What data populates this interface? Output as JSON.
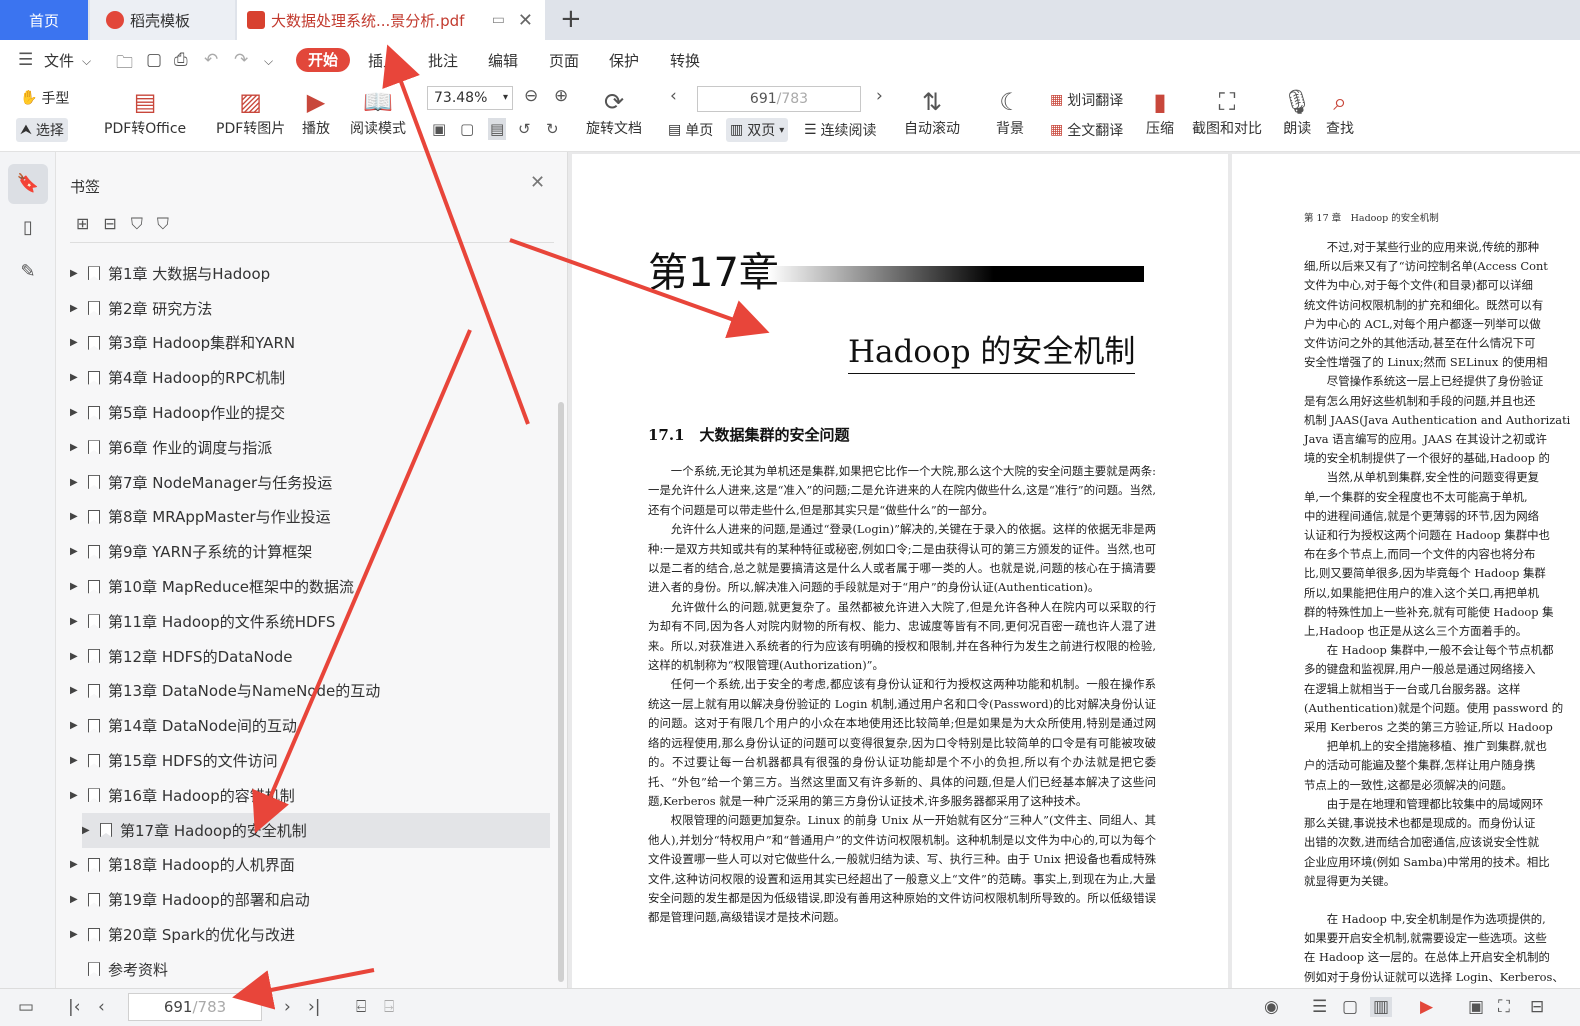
{
  "tabs": {
    "home": "首页",
    "wps": "稻壳模板",
    "doc": "大数据处理系统...景分析.pdf"
  },
  "menu": {
    "file": "文件",
    "start": "开始",
    "insert": "插入",
    "annotate": "批注",
    "edit": "编辑",
    "page": "页面",
    "protect": "保护",
    "convert": "转换"
  },
  "ribbon": {
    "hand": "手型",
    "select": "选择",
    "pdf_to_office": "PDF转Office",
    "pdf_to_image": "PDF转图片",
    "play": "播放",
    "read_mode": "阅读模式",
    "zoom": "73.48%",
    "rotate": "旋转文档",
    "page_current": "691",
    "page_total": "/783",
    "single": "单页",
    "double": "双页",
    "continuous": "连续阅读",
    "auto_scroll": "自动滚动",
    "background": "背景",
    "word_translate": "划词翻译",
    "full_translate": "全文翻译",
    "compress": "压缩",
    "screenshot_compare": "截图和对比",
    "read_aloud": "朗读",
    "find": "查找"
  },
  "panel": {
    "title": "书签",
    "bookmarks": [
      "第1章  大数据与Hadoop",
      "第2章  研究方法",
      "第3章  Hadoop集群和YARN",
      "第4章  Hadoop的RPC机制",
      "第5章  Hadoop作业的提交",
      "第6章  作业的调度与指派",
      "第7章  NodeManager与任务投运",
      "第8章  MRAppMaster与作业投运",
      "第9章  YARN子系统的计算框架",
      "第10章  MapReduce框架中的数据流",
      "第11章  Hadoop的文件系统HDFS",
      "第12章  HDFS的DataNode",
      "第13章  DataNode与NameNode的互动",
      "第14章  DataNode间的互动",
      "第15章  HDFS的文件访问",
      "第16章  Hadoop的容错机制",
      "第17章  Hadoop的安全机制",
      "第18章  Hadoop的人机界面",
      "第19章  Hadoop的部署和启动",
      "第20章  Spark的优化与改进",
      "参考资料"
    ]
  },
  "page1": {
    "chapter": "第17章",
    "title": "Hadoop 的安全机制",
    "section": "17.1　大数据集群的安全问题",
    "paragraphs": [
      "一个系统,无论其为单机还是集群,如果把它比作一个大院,那么这个大院的安全问题主要就是两条:一是允许什么人进来,这是“准入”的问题;二是允许进来的人在院内做些什么,这是“准行”的问题。当然,还有个问题是可以带走些什么,但是那其实只是“做些什么”的一部分。",
      "允许什么人进来的问题,是通过“登录(Login)”解决的,关键在于录入的依据。这样的依据无非是两种:一是双方共知或共有的某种特征或秘密,例如口令;二是由获得认可的第三方颁发的证件。当然,也可以是二者的结合,总之就是要搞清这是什么人或者属于哪一类的人。也就是说,问题的核心在于搞清要进入者的身份。所以,解决准入问题的手段就是对于“用户”的身份认证(Authentication)。",
      "允许做什么的问题,就更复杂了。虽然都被允许进入大院了,但是允许各种人在院内可以采取的行为却有不同,因为各人对院内财物的所有权、能力、忠诚度等皆有不同,更何况百密一疏也许人混了进来。所以,对获准进入系统者的行为应该有明确的授权和限制,并在各种行为发生之前进行权限的检验,这样的机制称为“权限管理(Authorization)”。",
      "任何一个系统,出于安全的考虑,都应该有身份认证和行为授权这两种功能和机制。一般在操作系统这一层上就有用以解决身份验证的 Login 机制,通过用户名和口令(Password)的比对解决身份认证的问题。这对于有限几个用户的小众在本地使用还比较简单;但是如果是为大众所使用,特别是通过网络的远程使用,那么身份认证的问题可以变得很复杂,因为口令特别是比较简单的口令是有可能被攻破的。不过要让每一台机器都具有很强的身份认证功能却是个不小的负担,所以有个办法就是把它委托、“外包”给一个第三方。当然这里面又有许多新的、具体的问题,但是人们已经基本解决了这些问题,Kerberos 就是一种广泛采用的第三方身份认证技术,许多服务器都采用了这种技术。",
      "权限管理的问题更加复杂。Linux 的前身 Unix 从一开始就有区分“三种人”(文件主、同组人、其他人),并划分“特权用户”和“普通用户”的文件访问权限机制。这种机制是以文件为中心的,可以为每个文件设置哪一些人可以对它做些什么,一般就归结为读、写、执行三种。由于 Unix 把设备也看成特殊文件,这种访问权限的设置和运用其实已经超出了一般意义上“文件”的范畴。事实上,到现在为止,大量安全问题的发生都是因为低级错误,即没有善用这种原始的文件访问权限机制所导致的。所以低级错误都是管理问题,高级错误才是技术问题。"
    ]
  },
  "page2": {
    "header": "第 17 章　Hadoop 的安全机制",
    "lines_a": [
      "不过,对于某些行业的应用来说,传统的那种",
      "细,所以后来又有了“访问控制名单(Access Cont",
      "文件为中心,对于每个文件(和目录)都可以详细",
      "统文件访问权限机制的扩充和细化。既然可以有",
      "户为中心的 ACL,对每个用户都逐一列举可以做",
      "文件访问之外的其他活动,甚至在什么情况下可",
      "安全性增强了的 Linux;然而 SELinux 的使用相",
      "尽管操作系统这一层上已经提供了身份验证",
      "是有怎么用好这些机制和手段的问题,并且也还",
      "机制 JAAS(Java Authentication and Authorizati",
      "Java 语言编写的应用。JAAS 在其设计之初或许",
      "境的安全机制提供了一个很好的基础,Hadoop 的",
      "当然,从单机到集群,安全性的问题变得更复",
      "单,一个集群的安全程度也不太可能高于单机,",
      "中的进程间通信,就是个更薄弱的环节,因为网络",
      "认证和行为授权这两个问题在 Hadoop 集群中也",
      "布在多个节点上,而同一个文件的内容也将分布",
      "比,则又要简单很多,因为毕竟每个 Hadoop 集群",
      "所以,如果能把住用户的准入这个关口,再把单机",
      "群的特殊性加上一些补充,就有可能使 Hadoop 集",
      "上,Hadoop 也正是从这么三个方面着手的。",
      "在 Hadoop 集群中,一般不会让每个节点机都",
      "多的键盘和监视屏,用户一般总是通过网络接入",
      "在逻辑上就相当于一台或几台服务器。这样",
      "(Authentication)就是个问题。使用 password 的",
      "采用 Kerberos 之类的第三方验证,所以 Hadoop",
      "把单机上的安全措施移植、推广到集群,就也",
      "户的活动可能遍及整个集群,怎样让用户随身携",
      "节点上的一致性,这都是必须解决的问题。",
      "由于是在地理和管理都比较集中的局域网环",
      "那么关键,事说技术也都是现成的。而身份认证",
      "出错的次数,进而结合加密通信,应该说安全性就",
      "企业应用环境(例如 Samba)中常用的技术。相比",
      "就显得更为关键。"
    ],
    "lines_b": [
      "在 Hadoop 中,安全机制是作为选项提供的,",
      "如果要开启安全机制,就需要设定一些选项。这些",
      "在 Hadoop 这一层的。在总体上开启安全机制的",
      "例如对于身份认证就可以选择 Login、Kerberos、"
    ]
  },
  "statusbar": {
    "page_current": "691",
    "page_total": "/783"
  },
  "colors": {
    "accent_red": "#e2473a",
    "tab_blue": "#3b74f0",
    "annotation_arrow": "#e8453a"
  }
}
